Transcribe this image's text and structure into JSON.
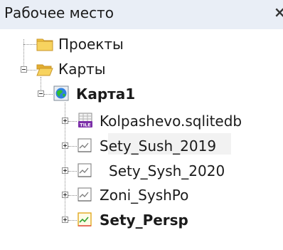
{
  "panel": {
    "title": "Рабочее место",
    "close_glyph": "×"
  },
  "tree": {
    "projects": {
      "label": "Проекты",
      "icon": "folder-closed-icon"
    },
    "maps": {
      "label": "Карты",
      "icon": "folder-open-icon",
      "expanded": true,
      "children": [
        {
          "label": "Карта1",
          "icon": "globe-map-icon",
          "bold": true,
          "expanded": true,
          "children": [
            {
              "label": "Kolpashevo.sqlitedb",
              "icon": "tile-layer-icon",
              "bold": false
            },
            {
              "label": "Sety_Sush_2019",
              "icon": "vector-layer-icon",
              "bold": false
            },
            {
              "label": "Sety_Sysh_2020",
              "icon": "vector-layer-icon",
              "bold": false
            },
            {
              "label": "Zoni_SyshPo",
              "icon": "vector-layer-icon",
              "bold": false
            },
            {
              "label": "Sety_Persp",
              "icon": "vector-layer-icon",
              "bold": true
            }
          ]
        }
      ]
    }
  },
  "colors": {
    "title_bg": "#e9eef6",
    "folder_yellow": "#f2c440",
    "globe_green": "#2fbf2f",
    "globe_blue": "#2f7fe0",
    "tile_badge": "#7b2ea8"
  }
}
